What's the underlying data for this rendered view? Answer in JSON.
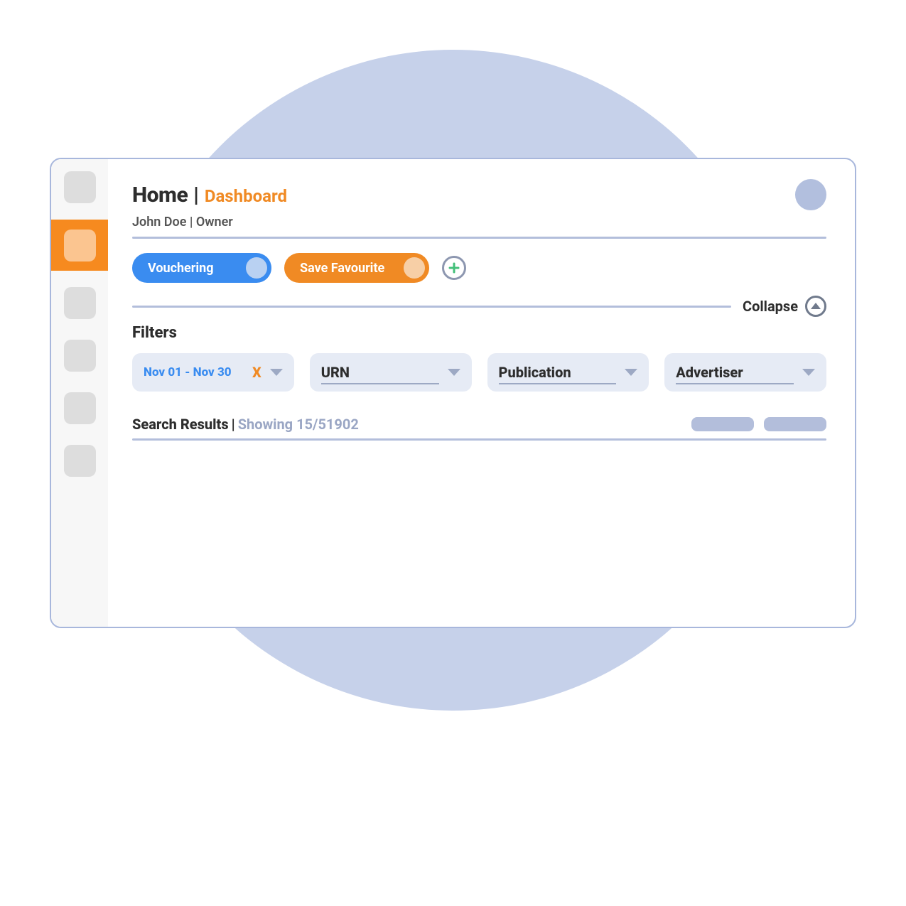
{
  "header": {
    "home": "Home",
    "pipe": "|",
    "dashboard": "Dashboard"
  },
  "subtitle": "John Doe | Owner",
  "chips": {
    "vouchering": "Vouchering",
    "save_favourite": "Save Favourite"
  },
  "collapse_label": "Collapse",
  "filters": {
    "heading": "Filters",
    "date_range": "Nov 01 - Nov 30",
    "clear": "X",
    "urn": "URN",
    "publication": "Publication",
    "advertiser": "Advertiser"
  },
  "results": {
    "label": "Search Results",
    "pipe": "|",
    "showing": "Showing 15/51902"
  }
}
